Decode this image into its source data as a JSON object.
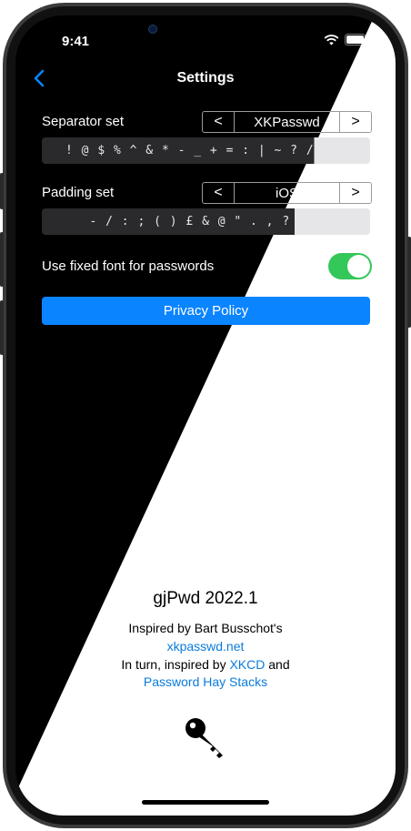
{
  "status": {
    "time": "9:41"
  },
  "nav": {
    "title": "Settings"
  },
  "separator": {
    "label": "Separator set",
    "prev": "<",
    "value": "XKPasswd",
    "next": ">",
    "characters": "! @ $ % ^ & * - _ + = : | ~ ? / . ;"
  },
  "padding": {
    "label": "Padding set",
    "prev": "<",
    "value": "iOS",
    "next": ">",
    "characters": "- / : ; ( ) £ & @ \" . , ? ! '"
  },
  "fixed_font": {
    "label": "Use fixed font for passwords",
    "on": true
  },
  "privacy_button": "Privacy Policy",
  "about": {
    "app_name": "gjPwd 2022.1",
    "inspired_by": "Inspired by Bart Busschot's",
    "xkpasswd_link": "xkpasswd.net",
    "in_turn": "In turn, inspired by",
    "xkcd_link": "XKCD",
    "and": "and",
    "hay_stacks_link": "Password Hay Stacks"
  },
  "colors": {
    "accent": "#0a84ff",
    "toggle_on": "#34c759",
    "link": "#0a7bdc"
  },
  "icons": [
    "back-chevron-icon",
    "wifi-icon",
    "battery-icon",
    "key-icon"
  ]
}
